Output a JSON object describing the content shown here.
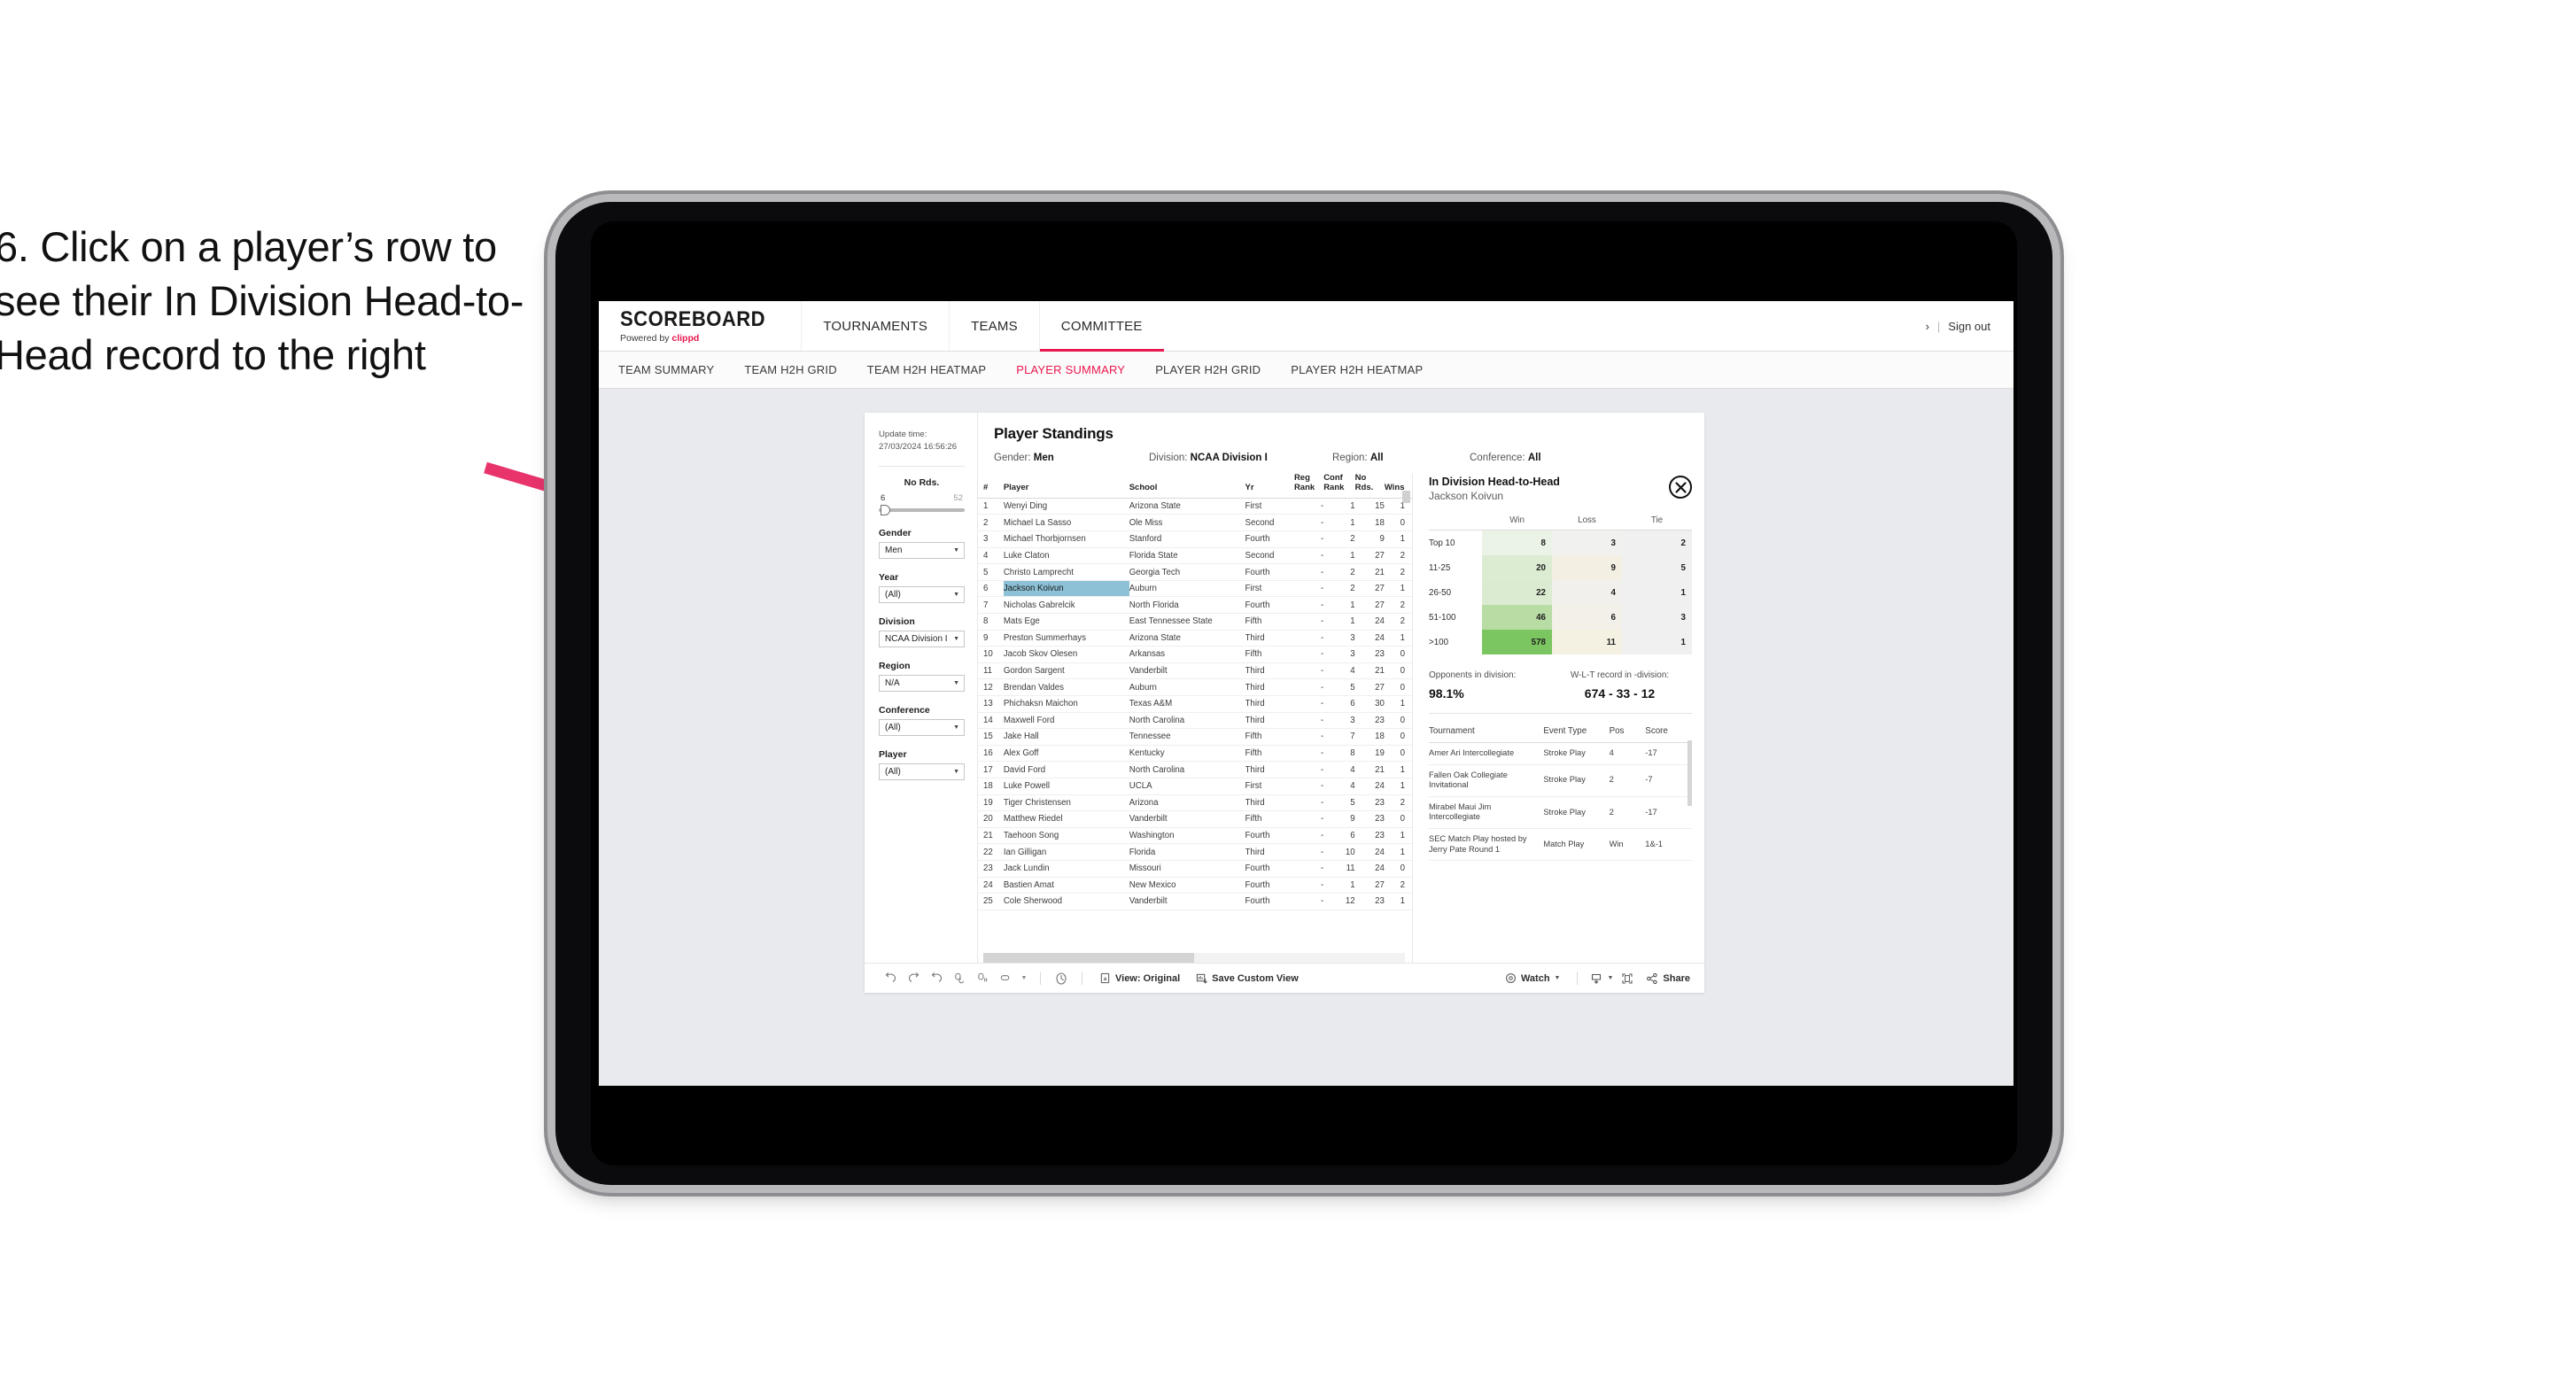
{
  "caption": "6. Click on a player’s row to see their In Division Head-to-Head record to the right",
  "topnav": {
    "brand_name": "SCOREBOARD",
    "brand_sub_prefix": "Powered by ",
    "brand_sub_accent": "clippd",
    "items": [
      {
        "label": "TOURNAMENTS",
        "active": false
      },
      {
        "label": "TEAMS",
        "active": false
      },
      {
        "label": "COMMITTEE",
        "active": true
      }
    ],
    "right_glyph": "›",
    "separator": "|",
    "sign_out": "Sign out"
  },
  "subnav": {
    "items": [
      {
        "label": "TEAM SUMMARY",
        "active": false
      },
      {
        "label": "TEAM H2H GRID",
        "active": false
      },
      {
        "label": "TEAM H2H HEATMAP",
        "active": false
      },
      {
        "label": "PLAYER SUMMARY",
        "active": true
      },
      {
        "label": "PLAYER H2H GRID",
        "active": false
      },
      {
        "label": "PLAYER H2H HEATMAP",
        "active": false
      }
    ]
  },
  "filters": {
    "update_time_label": "Update time:",
    "update_time_value": "27/03/2024 16:56:26",
    "slider": {
      "title": "No Rds.",
      "min": "6",
      "max": "52"
    },
    "groups": [
      {
        "label": "Gender",
        "value": "Men"
      },
      {
        "label": "Year",
        "value": "(All)"
      },
      {
        "label": "Division",
        "value": "NCAA Division I"
      },
      {
        "label": "Region",
        "value": "N/A"
      },
      {
        "label": "Conference",
        "value": "(All)"
      },
      {
        "label": "Player",
        "value": "(All)"
      }
    ]
  },
  "standings": {
    "title": "Player Standings",
    "summary": [
      {
        "key": "Gender: ",
        "value": "Men"
      },
      {
        "key": "Division: ",
        "value": "NCAA Division I"
      },
      {
        "key": "Region: ",
        "value": "All"
      },
      {
        "key": "Conference: ",
        "value": "All"
      }
    ],
    "columns": [
      "#",
      "Player",
      "School",
      "Yr",
      "Reg Rank",
      "Conf Rank",
      "No Rds.",
      "Wins"
    ],
    "rows": [
      {
        "rank": "1",
        "player": "Wenyi Ding",
        "school": "Arizona State",
        "yr": "First",
        "reg": "-",
        "conf": "1",
        "rds": "15",
        "wins": "1",
        "selected": false
      },
      {
        "rank": "2",
        "player": "Michael La Sasso",
        "school": "Ole Miss",
        "yr": "Second",
        "reg": "-",
        "conf": "1",
        "rds": "18",
        "wins": "0",
        "selected": false
      },
      {
        "rank": "3",
        "player": "Michael Thorbjornsen",
        "school": "Stanford",
        "yr": "Fourth",
        "reg": "-",
        "conf": "2",
        "rds": "9",
        "wins": "1",
        "selected": false
      },
      {
        "rank": "4",
        "player": "Luke Claton",
        "school": "Florida State",
        "yr": "Second",
        "reg": "-",
        "conf": "1",
        "rds": "27",
        "wins": "2",
        "selected": false
      },
      {
        "rank": "5",
        "player": "Christo Lamprecht",
        "school": "Georgia Tech",
        "yr": "Fourth",
        "reg": "-",
        "conf": "2",
        "rds": "21",
        "wins": "2",
        "selected": false
      },
      {
        "rank": "6",
        "player": "Jackson Koivun",
        "school": "Auburn",
        "yr": "First",
        "reg": "-",
        "conf": "2",
        "rds": "27",
        "wins": "1",
        "selected": true
      },
      {
        "rank": "7",
        "player": "Nicholas Gabrelcik",
        "school": "North Florida",
        "yr": "Fourth",
        "reg": "-",
        "conf": "1",
        "rds": "27",
        "wins": "2",
        "selected": false
      },
      {
        "rank": "8",
        "player": "Mats Ege",
        "school": "East Tennessee State",
        "yr": "Fifth",
        "reg": "-",
        "conf": "1",
        "rds": "24",
        "wins": "2",
        "selected": false
      },
      {
        "rank": "9",
        "player": "Preston Summerhays",
        "school": "Arizona State",
        "yr": "Third",
        "reg": "-",
        "conf": "3",
        "rds": "24",
        "wins": "1",
        "selected": false
      },
      {
        "rank": "10",
        "player": "Jacob Skov Olesen",
        "school": "Arkansas",
        "yr": "Fifth",
        "reg": "-",
        "conf": "3",
        "rds": "23",
        "wins": "0",
        "selected": false
      },
      {
        "rank": "11",
        "player": "Gordon Sargent",
        "school": "Vanderbilt",
        "yr": "Third",
        "reg": "-",
        "conf": "4",
        "rds": "21",
        "wins": "0",
        "selected": false
      },
      {
        "rank": "12",
        "player": "Brendan Valdes",
        "school": "Auburn",
        "yr": "Third",
        "reg": "-",
        "conf": "5",
        "rds": "27",
        "wins": "0",
        "selected": false
      },
      {
        "rank": "13",
        "player": "Phichaksn Maichon",
        "school": "Texas A&M",
        "yr": "Third",
        "reg": "-",
        "conf": "6",
        "rds": "30",
        "wins": "1",
        "selected": false
      },
      {
        "rank": "14",
        "player": "Maxwell Ford",
        "school": "North Carolina",
        "yr": "Third",
        "reg": "-",
        "conf": "3",
        "rds": "23",
        "wins": "0",
        "selected": false
      },
      {
        "rank": "15",
        "player": "Jake Hall",
        "school": "Tennessee",
        "yr": "Fifth",
        "reg": "-",
        "conf": "7",
        "rds": "18",
        "wins": "0",
        "selected": false
      },
      {
        "rank": "16",
        "player": "Alex Goff",
        "school": "Kentucky",
        "yr": "Fifth",
        "reg": "-",
        "conf": "8",
        "rds": "19",
        "wins": "0",
        "selected": false
      },
      {
        "rank": "17",
        "player": "David Ford",
        "school": "North Carolina",
        "yr": "Third",
        "reg": "-",
        "conf": "4",
        "rds": "21",
        "wins": "1",
        "selected": false
      },
      {
        "rank": "18",
        "player": "Luke Powell",
        "school": "UCLA",
        "yr": "First",
        "reg": "-",
        "conf": "4",
        "rds": "24",
        "wins": "1",
        "selected": false
      },
      {
        "rank": "19",
        "player": "Tiger Christensen",
        "school": "Arizona",
        "yr": "Third",
        "reg": "-",
        "conf": "5",
        "rds": "23",
        "wins": "2",
        "selected": false
      },
      {
        "rank": "20",
        "player": "Matthew Riedel",
        "school": "Vanderbilt",
        "yr": "Fifth",
        "reg": "-",
        "conf": "9",
        "rds": "23",
        "wins": "0",
        "selected": false
      },
      {
        "rank": "21",
        "player": "Taehoon Song",
        "school": "Washington",
        "yr": "Fourth",
        "reg": "-",
        "conf": "6",
        "rds": "23",
        "wins": "1",
        "selected": false
      },
      {
        "rank": "22",
        "player": "Ian Gilligan",
        "school": "Florida",
        "yr": "Third",
        "reg": "-",
        "conf": "10",
        "rds": "24",
        "wins": "1",
        "selected": false
      },
      {
        "rank": "23",
        "player": "Jack Lundin",
        "school": "Missouri",
        "yr": "Fourth",
        "reg": "-",
        "conf": "11",
        "rds": "24",
        "wins": "0",
        "selected": false
      },
      {
        "rank": "24",
        "player": "Bastien Amat",
        "school": "New Mexico",
        "yr": "Fourth",
        "reg": "-",
        "conf": "1",
        "rds": "27",
        "wins": "2",
        "selected": false
      },
      {
        "rank": "25",
        "player": "Cole Sherwood",
        "school": "Vanderbilt",
        "yr": "Fourth",
        "reg": "-",
        "conf": "12",
        "rds": "23",
        "wins": "1",
        "selected": false
      }
    ]
  },
  "h2h": {
    "title": "In Division Head-to-Head",
    "player": "Jackson Koivun",
    "close_icon": "close-icon",
    "columns": [
      "Win",
      "Loss",
      "Tie"
    ],
    "rows": [
      {
        "label": "Top 10",
        "win": "8",
        "loss": "3",
        "tie": "2",
        "win_color": "#eaf3e6",
        "loss_color": "#f1f1ef",
        "tie_color": "#f0f0f0"
      },
      {
        "label": "11-25",
        "win": "20",
        "loss": "9",
        "tie": "5",
        "win_color": "#dcecd2",
        "loss_color": "#f3f0e3",
        "tie_color": "#f0f0f0"
      },
      {
        "label": "26-50",
        "win": "22",
        "loss": "4",
        "tie": "1",
        "win_color": "#dbebd1",
        "loss_color": "#f1f0ec",
        "tie_color": "#f0f0f0"
      },
      {
        "label": "51-100",
        "win": "46",
        "loss": "6",
        "tie": "3",
        "win_color": "#b7dca4",
        "loss_color": "#f2f0e8",
        "tie_color": "#f0f0f0"
      },
      {
        "label": ">100",
        "win": "578",
        "loss": "11",
        "tie": "1",
        "win_color": "#7cc662",
        "loss_color": "#f4f0e2",
        "tie_color": "#f0f0f0"
      }
    ],
    "metrics": [
      {
        "key": "Opponents in division:",
        "value": "98.1%"
      },
      {
        "key": "W-L-T record in -division:",
        "value": "674 - 33 - 12"
      }
    ],
    "tournament_columns": [
      "Tournament",
      "Event Type",
      "Pos",
      "Score"
    ],
    "tournaments": [
      {
        "name": "Amer Ari Intercollegiate",
        "type": "Stroke Play",
        "pos": "4",
        "score": "-17"
      },
      {
        "name": "Fallen Oak Collegiate Invitational",
        "type": "Stroke Play",
        "pos": "2",
        "score": "-7"
      },
      {
        "name": "Mirabel Maui Jim Intercollegiate",
        "type": "Stroke Play",
        "pos": "2",
        "score": "-17"
      },
      {
        "name": "SEC Match Play hosted by Jerry Pate Round 1",
        "type": "Match Play",
        "pos": "Win",
        "score": "1&-1"
      }
    ]
  },
  "toolbar": {
    "view_label": "View: Original",
    "save_label": "Save Custom View",
    "watch_label": "Watch",
    "share_label": "Share"
  },
  "colors": {
    "accent": "#e8174e",
    "selected_row": "#8dc1d6",
    "screen_bg": "#e9eaee"
  }
}
